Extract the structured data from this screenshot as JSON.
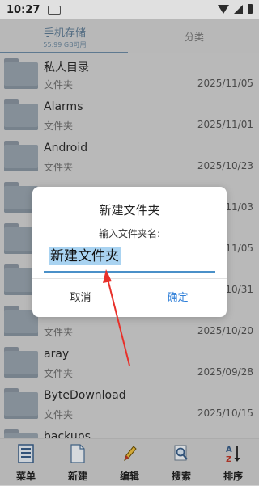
{
  "status_bar": {
    "time": "10:27"
  },
  "tabs": [
    {
      "label": "手机存储",
      "sublabel": "55.99 GB可用",
      "active": true
    },
    {
      "label": "分类",
      "active": false
    }
  ],
  "files": [
    {
      "name": "私人目录",
      "type": "文件夹",
      "date": "2025/11/05"
    },
    {
      "name": "Alarms",
      "type": "文件夹",
      "date": "2025/11/01"
    },
    {
      "name": "Android",
      "type": "文件夹",
      "date": "2025/10/23"
    },
    {
      "name": "",
      "type": "",
      "date": "2025/11/03"
    },
    {
      "name": "",
      "type": "",
      "date": "2025/11/05"
    },
    {
      "name": "",
      "type": "",
      "date": "2025/10/31"
    },
    {
      "name": "",
      "type": "文件夹",
      "date": "2025/10/20"
    },
    {
      "name": "aray",
      "type": "文件夹",
      "date": "2025/09/28"
    },
    {
      "name": "ByteDownload",
      "type": "文件夹",
      "date": "2025/10/15"
    },
    {
      "name": "backups",
      "type": "",
      "date": ""
    }
  ],
  "bottom_bar": [
    {
      "label": "菜单",
      "icon": "menu-list-icon"
    },
    {
      "label": "新建",
      "icon": "new-file-icon"
    },
    {
      "label": "编辑",
      "icon": "edit-pencil-icon"
    },
    {
      "label": "搜索",
      "icon": "search-magnifier-icon"
    },
    {
      "label": "排序",
      "icon": "sort-az-icon"
    }
  ],
  "dialog": {
    "title": "新建文件夹",
    "prompt": "输入文件夹名:",
    "input_value": "新建文件夹",
    "cancel_label": "取消",
    "ok_label": "确定"
  },
  "colors": {
    "accent": "#2f7fd8",
    "annotation_arrow": "#e8302a",
    "selection": "#a9d3f1"
  }
}
